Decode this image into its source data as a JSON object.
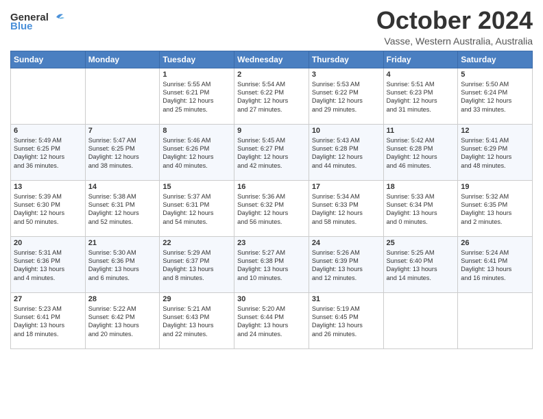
{
  "logo": {
    "line1": "General",
    "line2": "Blue"
  },
  "title": "October 2024",
  "subtitle": "Vasse, Western Australia, Australia",
  "days_of_week": [
    "Sunday",
    "Monday",
    "Tuesday",
    "Wednesday",
    "Thursday",
    "Friday",
    "Saturday"
  ],
  "weeks": [
    [
      {
        "day": "",
        "lines": []
      },
      {
        "day": "",
        "lines": []
      },
      {
        "day": "1",
        "lines": [
          "Sunrise: 5:55 AM",
          "Sunset: 6:21 PM",
          "Daylight: 12 hours",
          "and 25 minutes."
        ]
      },
      {
        "day": "2",
        "lines": [
          "Sunrise: 5:54 AM",
          "Sunset: 6:22 PM",
          "Daylight: 12 hours",
          "and 27 minutes."
        ]
      },
      {
        "day": "3",
        "lines": [
          "Sunrise: 5:53 AM",
          "Sunset: 6:22 PM",
          "Daylight: 12 hours",
          "and 29 minutes."
        ]
      },
      {
        "day": "4",
        "lines": [
          "Sunrise: 5:51 AM",
          "Sunset: 6:23 PM",
          "Daylight: 12 hours",
          "and 31 minutes."
        ]
      },
      {
        "day": "5",
        "lines": [
          "Sunrise: 5:50 AM",
          "Sunset: 6:24 PM",
          "Daylight: 12 hours",
          "and 33 minutes."
        ]
      }
    ],
    [
      {
        "day": "6",
        "lines": [
          "Sunrise: 5:49 AM",
          "Sunset: 6:25 PM",
          "Daylight: 12 hours",
          "and 36 minutes."
        ]
      },
      {
        "day": "7",
        "lines": [
          "Sunrise: 5:47 AM",
          "Sunset: 6:25 PM",
          "Daylight: 12 hours",
          "and 38 minutes."
        ]
      },
      {
        "day": "8",
        "lines": [
          "Sunrise: 5:46 AM",
          "Sunset: 6:26 PM",
          "Daylight: 12 hours",
          "and 40 minutes."
        ]
      },
      {
        "day": "9",
        "lines": [
          "Sunrise: 5:45 AM",
          "Sunset: 6:27 PM",
          "Daylight: 12 hours",
          "and 42 minutes."
        ]
      },
      {
        "day": "10",
        "lines": [
          "Sunrise: 5:43 AM",
          "Sunset: 6:28 PM",
          "Daylight: 12 hours",
          "and 44 minutes."
        ]
      },
      {
        "day": "11",
        "lines": [
          "Sunrise: 5:42 AM",
          "Sunset: 6:28 PM",
          "Daylight: 12 hours",
          "and 46 minutes."
        ]
      },
      {
        "day": "12",
        "lines": [
          "Sunrise: 5:41 AM",
          "Sunset: 6:29 PM",
          "Daylight: 12 hours",
          "and 48 minutes."
        ]
      }
    ],
    [
      {
        "day": "13",
        "lines": [
          "Sunrise: 5:39 AM",
          "Sunset: 6:30 PM",
          "Daylight: 12 hours",
          "and 50 minutes."
        ]
      },
      {
        "day": "14",
        "lines": [
          "Sunrise: 5:38 AM",
          "Sunset: 6:31 PM",
          "Daylight: 12 hours",
          "and 52 minutes."
        ]
      },
      {
        "day": "15",
        "lines": [
          "Sunrise: 5:37 AM",
          "Sunset: 6:31 PM",
          "Daylight: 12 hours",
          "and 54 minutes."
        ]
      },
      {
        "day": "16",
        "lines": [
          "Sunrise: 5:36 AM",
          "Sunset: 6:32 PM",
          "Daylight: 12 hours",
          "and 56 minutes."
        ]
      },
      {
        "day": "17",
        "lines": [
          "Sunrise: 5:34 AM",
          "Sunset: 6:33 PM",
          "Daylight: 12 hours",
          "and 58 minutes."
        ]
      },
      {
        "day": "18",
        "lines": [
          "Sunrise: 5:33 AM",
          "Sunset: 6:34 PM",
          "Daylight: 13 hours",
          "and 0 minutes."
        ]
      },
      {
        "day": "19",
        "lines": [
          "Sunrise: 5:32 AM",
          "Sunset: 6:35 PM",
          "Daylight: 13 hours",
          "and 2 minutes."
        ]
      }
    ],
    [
      {
        "day": "20",
        "lines": [
          "Sunrise: 5:31 AM",
          "Sunset: 6:36 PM",
          "Daylight: 13 hours",
          "and 4 minutes."
        ]
      },
      {
        "day": "21",
        "lines": [
          "Sunrise: 5:30 AM",
          "Sunset: 6:36 PM",
          "Daylight: 13 hours",
          "and 6 minutes."
        ]
      },
      {
        "day": "22",
        "lines": [
          "Sunrise: 5:29 AM",
          "Sunset: 6:37 PM",
          "Daylight: 13 hours",
          "and 8 minutes."
        ]
      },
      {
        "day": "23",
        "lines": [
          "Sunrise: 5:27 AM",
          "Sunset: 6:38 PM",
          "Daylight: 13 hours",
          "and 10 minutes."
        ]
      },
      {
        "day": "24",
        "lines": [
          "Sunrise: 5:26 AM",
          "Sunset: 6:39 PM",
          "Daylight: 13 hours",
          "and 12 minutes."
        ]
      },
      {
        "day": "25",
        "lines": [
          "Sunrise: 5:25 AM",
          "Sunset: 6:40 PM",
          "Daylight: 13 hours",
          "and 14 minutes."
        ]
      },
      {
        "day": "26",
        "lines": [
          "Sunrise: 5:24 AM",
          "Sunset: 6:41 PM",
          "Daylight: 13 hours",
          "and 16 minutes."
        ]
      }
    ],
    [
      {
        "day": "27",
        "lines": [
          "Sunrise: 5:23 AM",
          "Sunset: 6:41 PM",
          "Daylight: 13 hours",
          "and 18 minutes."
        ]
      },
      {
        "day": "28",
        "lines": [
          "Sunrise: 5:22 AM",
          "Sunset: 6:42 PM",
          "Daylight: 13 hours",
          "and 20 minutes."
        ]
      },
      {
        "day": "29",
        "lines": [
          "Sunrise: 5:21 AM",
          "Sunset: 6:43 PM",
          "Daylight: 13 hours",
          "and 22 minutes."
        ]
      },
      {
        "day": "30",
        "lines": [
          "Sunrise: 5:20 AM",
          "Sunset: 6:44 PM",
          "Daylight: 13 hours",
          "and 24 minutes."
        ]
      },
      {
        "day": "31",
        "lines": [
          "Sunrise: 5:19 AM",
          "Sunset: 6:45 PM",
          "Daylight: 13 hours",
          "and 26 minutes."
        ]
      },
      {
        "day": "",
        "lines": []
      },
      {
        "day": "",
        "lines": []
      }
    ]
  ]
}
